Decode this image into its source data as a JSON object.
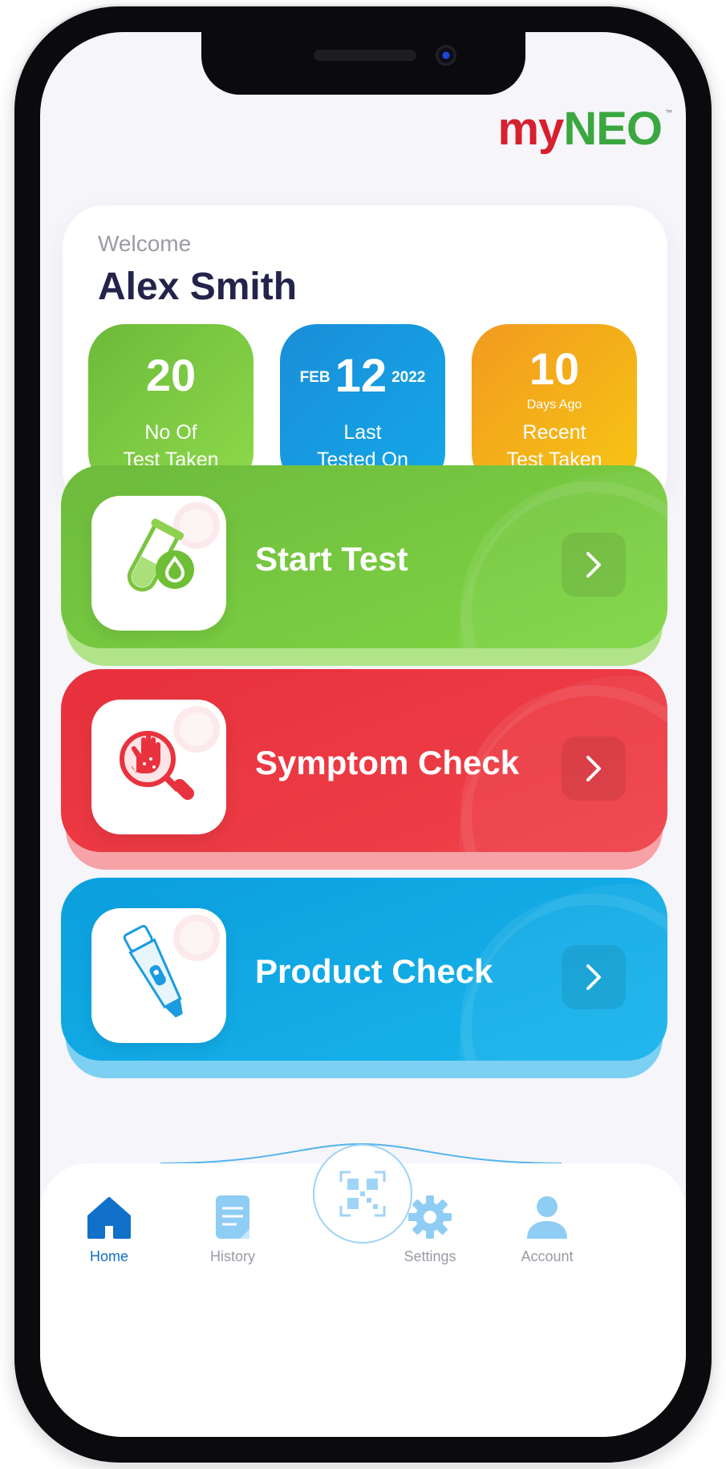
{
  "brand": {
    "logo_my": "my",
    "logo_neo": "NEO",
    "logo_tm": "™"
  },
  "welcome": {
    "label": "Welcome",
    "user_name": "Alex Smith",
    "stats": [
      {
        "value": "20",
        "label_line1": "No Of",
        "label_line2": "Test Taken",
        "color": "#7cc741"
      },
      {
        "month": "FEB",
        "day": "12",
        "year": "2022",
        "label_line1": "Last",
        "label_line2": "Tested On",
        "color": "#1499e0"
      },
      {
        "value": "10",
        "sublabel": "Days Ago",
        "label_line1": "Recent",
        "label_line2": "Test Taken",
        "color": "#f4b018"
      }
    ]
  },
  "actions": [
    {
      "label": "Start Test",
      "icon": "test-tube-drop-icon",
      "color": "#77c940"
    },
    {
      "label": "Symptom Check",
      "icon": "hand-magnifier-icon",
      "color": "#ec3a43"
    },
    {
      "label": "Product Check",
      "icon": "test-device-icon",
      "color": "#12abe6"
    }
  ],
  "bottom_nav": {
    "items": [
      {
        "label": "Home",
        "icon": "home-icon",
        "active": true
      },
      {
        "label": "History",
        "icon": "document-icon",
        "active": false
      },
      {
        "label": "Settings",
        "icon": "gear-icon",
        "active": false
      },
      {
        "label": "Account",
        "icon": "user-icon",
        "active": false
      }
    ],
    "center_icon": "qr-code-icon"
  },
  "colors": {
    "active_nav": "#1170c9",
    "inactive_icon": "#9fd4f6",
    "title": "#23234b"
  }
}
